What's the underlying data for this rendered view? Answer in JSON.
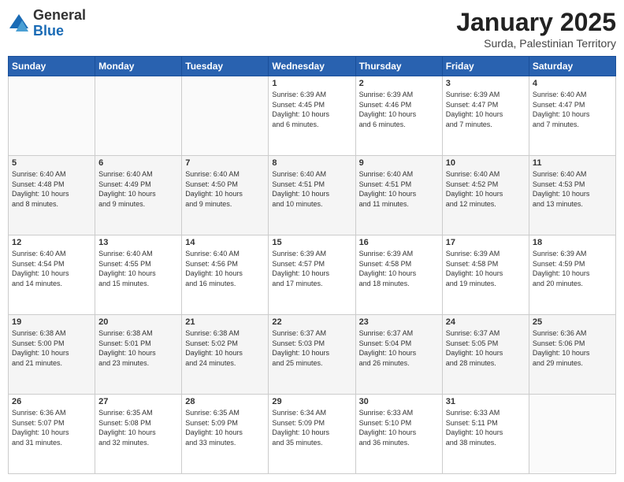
{
  "logo": {
    "general": "General",
    "blue": "Blue"
  },
  "header": {
    "month": "January 2025",
    "location": "Surda, Palestinian Territory"
  },
  "weekdays": [
    "Sunday",
    "Monday",
    "Tuesday",
    "Wednesday",
    "Thursday",
    "Friday",
    "Saturday"
  ],
  "weeks": [
    [
      {
        "day": "",
        "info": ""
      },
      {
        "day": "",
        "info": ""
      },
      {
        "day": "",
        "info": ""
      },
      {
        "day": "1",
        "info": "Sunrise: 6:39 AM\nSunset: 4:45 PM\nDaylight: 10 hours\nand 6 minutes."
      },
      {
        "day": "2",
        "info": "Sunrise: 6:39 AM\nSunset: 4:46 PM\nDaylight: 10 hours\nand 6 minutes."
      },
      {
        "day": "3",
        "info": "Sunrise: 6:39 AM\nSunset: 4:47 PM\nDaylight: 10 hours\nand 7 minutes."
      },
      {
        "day": "4",
        "info": "Sunrise: 6:40 AM\nSunset: 4:47 PM\nDaylight: 10 hours\nand 7 minutes."
      }
    ],
    [
      {
        "day": "5",
        "info": "Sunrise: 6:40 AM\nSunset: 4:48 PM\nDaylight: 10 hours\nand 8 minutes."
      },
      {
        "day": "6",
        "info": "Sunrise: 6:40 AM\nSunset: 4:49 PM\nDaylight: 10 hours\nand 9 minutes."
      },
      {
        "day": "7",
        "info": "Sunrise: 6:40 AM\nSunset: 4:50 PM\nDaylight: 10 hours\nand 9 minutes."
      },
      {
        "day": "8",
        "info": "Sunrise: 6:40 AM\nSunset: 4:51 PM\nDaylight: 10 hours\nand 10 minutes."
      },
      {
        "day": "9",
        "info": "Sunrise: 6:40 AM\nSunset: 4:51 PM\nDaylight: 10 hours\nand 11 minutes."
      },
      {
        "day": "10",
        "info": "Sunrise: 6:40 AM\nSunset: 4:52 PM\nDaylight: 10 hours\nand 12 minutes."
      },
      {
        "day": "11",
        "info": "Sunrise: 6:40 AM\nSunset: 4:53 PM\nDaylight: 10 hours\nand 13 minutes."
      }
    ],
    [
      {
        "day": "12",
        "info": "Sunrise: 6:40 AM\nSunset: 4:54 PM\nDaylight: 10 hours\nand 14 minutes."
      },
      {
        "day": "13",
        "info": "Sunrise: 6:40 AM\nSunset: 4:55 PM\nDaylight: 10 hours\nand 15 minutes."
      },
      {
        "day": "14",
        "info": "Sunrise: 6:40 AM\nSunset: 4:56 PM\nDaylight: 10 hours\nand 16 minutes."
      },
      {
        "day": "15",
        "info": "Sunrise: 6:39 AM\nSunset: 4:57 PM\nDaylight: 10 hours\nand 17 minutes."
      },
      {
        "day": "16",
        "info": "Sunrise: 6:39 AM\nSunset: 4:58 PM\nDaylight: 10 hours\nand 18 minutes."
      },
      {
        "day": "17",
        "info": "Sunrise: 6:39 AM\nSunset: 4:58 PM\nDaylight: 10 hours\nand 19 minutes."
      },
      {
        "day": "18",
        "info": "Sunrise: 6:39 AM\nSunset: 4:59 PM\nDaylight: 10 hours\nand 20 minutes."
      }
    ],
    [
      {
        "day": "19",
        "info": "Sunrise: 6:38 AM\nSunset: 5:00 PM\nDaylight: 10 hours\nand 21 minutes."
      },
      {
        "day": "20",
        "info": "Sunrise: 6:38 AM\nSunset: 5:01 PM\nDaylight: 10 hours\nand 23 minutes."
      },
      {
        "day": "21",
        "info": "Sunrise: 6:38 AM\nSunset: 5:02 PM\nDaylight: 10 hours\nand 24 minutes."
      },
      {
        "day": "22",
        "info": "Sunrise: 6:37 AM\nSunset: 5:03 PM\nDaylight: 10 hours\nand 25 minutes."
      },
      {
        "day": "23",
        "info": "Sunrise: 6:37 AM\nSunset: 5:04 PM\nDaylight: 10 hours\nand 26 minutes."
      },
      {
        "day": "24",
        "info": "Sunrise: 6:37 AM\nSunset: 5:05 PM\nDaylight: 10 hours\nand 28 minutes."
      },
      {
        "day": "25",
        "info": "Sunrise: 6:36 AM\nSunset: 5:06 PM\nDaylight: 10 hours\nand 29 minutes."
      }
    ],
    [
      {
        "day": "26",
        "info": "Sunrise: 6:36 AM\nSunset: 5:07 PM\nDaylight: 10 hours\nand 31 minutes."
      },
      {
        "day": "27",
        "info": "Sunrise: 6:35 AM\nSunset: 5:08 PM\nDaylight: 10 hours\nand 32 minutes."
      },
      {
        "day": "28",
        "info": "Sunrise: 6:35 AM\nSunset: 5:09 PM\nDaylight: 10 hours\nand 33 minutes."
      },
      {
        "day": "29",
        "info": "Sunrise: 6:34 AM\nSunset: 5:09 PM\nDaylight: 10 hours\nand 35 minutes."
      },
      {
        "day": "30",
        "info": "Sunrise: 6:33 AM\nSunset: 5:10 PM\nDaylight: 10 hours\nand 36 minutes."
      },
      {
        "day": "31",
        "info": "Sunrise: 6:33 AM\nSunset: 5:11 PM\nDaylight: 10 hours\nand 38 minutes."
      },
      {
        "day": "",
        "info": ""
      }
    ]
  ]
}
